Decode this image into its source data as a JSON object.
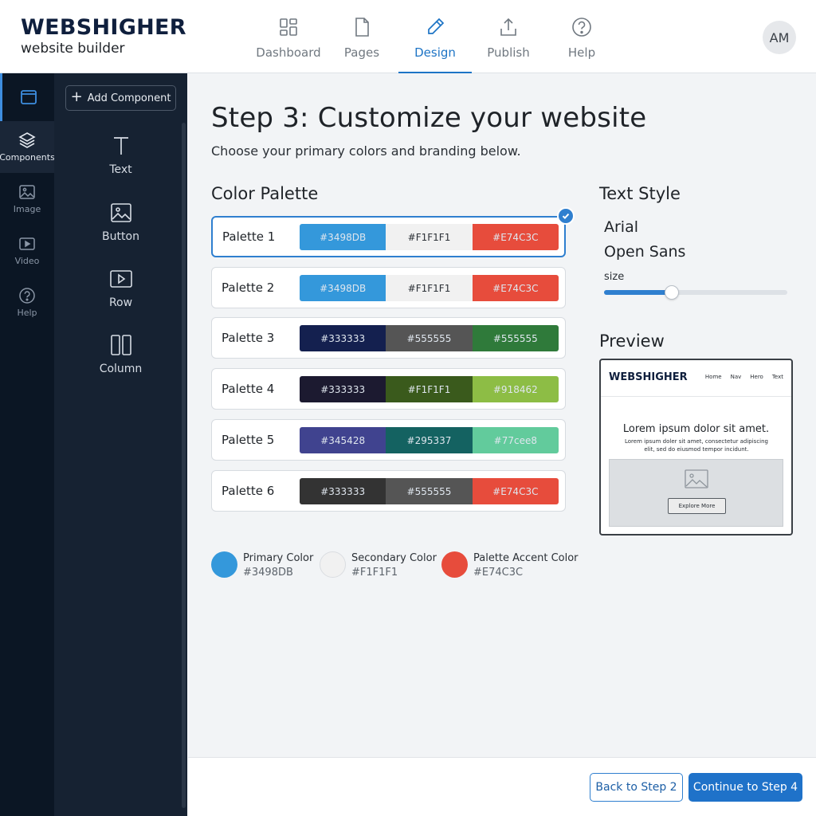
{
  "brand": {
    "name": "WEBSHIGHER",
    "tagline": "website builder"
  },
  "nav": [
    {
      "label": "Dashboard",
      "icon": "dashboard-icon"
    },
    {
      "label": "Pages",
      "icon": "page-icon"
    },
    {
      "label": "Design",
      "icon": "pen-icon",
      "active": true
    },
    {
      "label": "Publish",
      "icon": "upload-icon"
    },
    {
      "label": "Help",
      "icon": "help-icon"
    }
  ],
  "user": {
    "initials": "AM"
  },
  "rail": [
    {
      "label": "",
      "icon": "window-icon"
    },
    {
      "label": "Components",
      "icon": "layers-icon",
      "active": true
    },
    {
      "label": "Image",
      "icon": "image-icon"
    },
    {
      "label": "Video",
      "icon": "video-icon"
    },
    {
      "label": "Help",
      "icon": "help-icon"
    }
  ],
  "panel": {
    "add_label": "Add Component",
    "components": [
      {
        "label": "Text",
        "icon": "text-icon"
      },
      {
        "label": "Button",
        "icon": "image-icon"
      },
      {
        "label": "Row",
        "icon": "play-box-icon"
      },
      {
        "label": "Column",
        "icon": "columns-icon"
      }
    ]
  },
  "main": {
    "title": "Step 3: Customize your website",
    "intro": "Choose your primary colors and branding below.",
    "palette_heading": "Color Palette",
    "text_style_heading": "Text Style",
    "preview_heading": "Preview"
  },
  "palettes": [
    {
      "name": "Palette 1",
      "selected": true,
      "swatches": [
        {
          "label": "#3498DB",
          "color": "#3498DB"
        },
        {
          "label": "#F1F1F1",
          "color": "#F1F1F1",
          "light": true
        },
        {
          "label": "#E74C3C",
          "color": "#E74C3C"
        }
      ]
    },
    {
      "name": "Palette 2",
      "swatches": [
        {
          "label": "#3498DB",
          "color": "#3498DB"
        },
        {
          "label": "#F1F1F1",
          "color": "#F1F1F1",
          "light": true
        },
        {
          "label": "#E74C3C",
          "color": "#E74C3C"
        }
      ]
    },
    {
      "name": "Palette 3",
      "swatches": [
        {
          "label": "#333333",
          "color": "#14204f"
        },
        {
          "label": "#555555",
          "color": "#555555"
        },
        {
          "label": "#555555",
          "color": "#2f7a3a"
        }
      ]
    },
    {
      "name": "Palette 4",
      "swatches": [
        {
          "label": "#333333",
          "color": "#1c1a30"
        },
        {
          "label": "#F1F1F1",
          "color": "#3a5a1c"
        },
        {
          "label": "#918462",
          "color": "#8dbd45"
        }
      ]
    },
    {
      "name": "Palette 5",
      "swatches": [
        {
          "label": "#345428",
          "color": "#40438f"
        },
        {
          "label": "#295337",
          "color": "#146261"
        },
        {
          "label": "#77cee8",
          "color": "#62cb9c"
        }
      ]
    },
    {
      "name": "Palette 6",
      "swatches": [
        {
          "label": "#333333",
          "color": "#333333"
        },
        {
          "label": "#555555",
          "color": "#555555"
        },
        {
          "label": "#E74C3C",
          "color": "#E74C3C"
        }
      ]
    }
  ],
  "legend": [
    {
      "label": "Primary Color",
      "hex": "#3498DB",
      "color": "#3498DB"
    },
    {
      "label": "Secondary Color",
      "hex": "#F1F1F1",
      "color": "#F1F1F1"
    },
    {
      "label": "Palette Accent Color",
      "hex": "#E74C3C",
      "color": "#E74C3C"
    }
  ],
  "text_style": {
    "fonts": [
      "Arial",
      "Open Sans"
    ],
    "size_label": "size",
    "size_value": 0.37
  },
  "preview": {
    "brand": "WEBSHIGHER",
    "nav": [
      "Home",
      "Nav",
      "Hero",
      "Text"
    ],
    "title": "Lorem ipsum dolor sit amet.",
    "body": "Lorem ipsum doler sit amet, consectetur adipiscing elit, sed do eiusmod tempor incidunt.",
    "button": "Explore More"
  },
  "footer": {
    "back_label": "Back to Step 2",
    "next_label": "Continue to Step 4"
  }
}
